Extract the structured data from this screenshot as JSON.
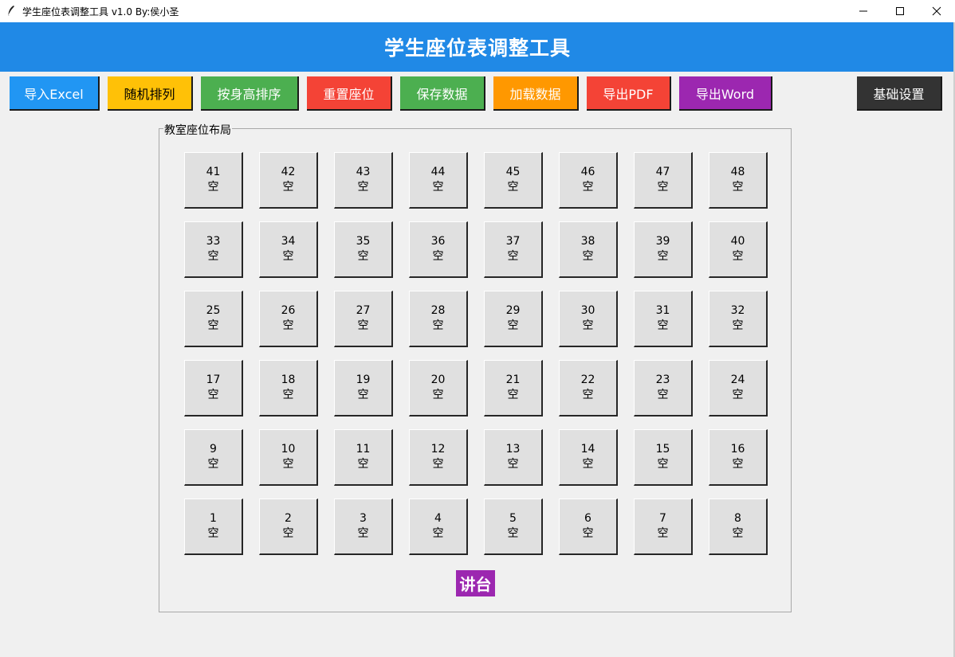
{
  "window": {
    "title": "学生座位表调整工具 v1.0 By:侯小圣"
  },
  "header": {
    "title": "学生座位表调整工具"
  },
  "toolbar": {
    "buttons": [
      {
        "label": "导入Excel",
        "color": "#2196f3"
      },
      {
        "label": "随机排列",
        "color": "#ffc107"
      },
      {
        "label": "按身高排序",
        "color": "#4caf50"
      },
      {
        "label": "重置座位",
        "color": "#f44336"
      },
      {
        "label": "保存数据",
        "color": "#4caf50"
      },
      {
        "label": "加载数据",
        "color": "#ff9800"
      },
      {
        "label": "导出PDF",
        "color": "#f44336"
      },
      {
        "label": "导出Word",
        "color": "#9c27b0"
      },
      {
        "label": "基础设置",
        "color": "#333333"
      }
    ]
  },
  "classroom": {
    "label": "教室座位布局",
    "rows": [
      [
        {
          "num": "41",
          "name": "空"
        },
        {
          "num": "42",
          "name": "空"
        },
        {
          "num": "43",
          "name": "空"
        },
        {
          "num": "44",
          "name": "空"
        },
        {
          "num": "45",
          "name": "空"
        },
        {
          "num": "46",
          "name": "空"
        },
        {
          "num": "47",
          "name": "空"
        },
        {
          "num": "48",
          "name": "空"
        }
      ],
      [
        {
          "num": "33",
          "name": "空"
        },
        {
          "num": "34",
          "name": "空"
        },
        {
          "num": "35",
          "name": "空"
        },
        {
          "num": "36",
          "name": "空"
        },
        {
          "num": "37",
          "name": "空"
        },
        {
          "num": "38",
          "name": "空"
        },
        {
          "num": "39",
          "name": "空"
        },
        {
          "num": "40",
          "name": "空"
        }
      ],
      [
        {
          "num": "25",
          "name": "空"
        },
        {
          "num": "26",
          "name": "空"
        },
        {
          "num": "27",
          "name": "空"
        },
        {
          "num": "28",
          "name": "空"
        },
        {
          "num": "29",
          "name": "空"
        },
        {
          "num": "30",
          "name": "空"
        },
        {
          "num": "31",
          "name": "空"
        },
        {
          "num": "32",
          "name": "空"
        }
      ],
      [
        {
          "num": "17",
          "name": "空"
        },
        {
          "num": "18",
          "name": "空"
        },
        {
          "num": "19",
          "name": "空"
        },
        {
          "num": "20",
          "name": "空"
        },
        {
          "num": "21",
          "name": "空"
        },
        {
          "num": "22",
          "name": "空"
        },
        {
          "num": "23",
          "name": "空"
        },
        {
          "num": "24",
          "name": "空"
        }
      ],
      [
        {
          "num": "9",
          "name": "空"
        },
        {
          "num": "10",
          "name": "空"
        },
        {
          "num": "11",
          "name": "空"
        },
        {
          "num": "12",
          "name": "空"
        },
        {
          "num": "13",
          "name": "空"
        },
        {
          "num": "14",
          "name": "空"
        },
        {
          "num": "15",
          "name": "空"
        },
        {
          "num": "16",
          "name": "空"
        }
      ],
      [
        {
          "num": "1",
          "name": "空"
        },
        {
          "num": "2",
          "name": "空"
        },
        {
          "num": "3",
          "name": "空"
        },
        {
          "num": "4",
          "name": "空"
        },
        {
          "num": "5",
          "name": "空"
        },
        {
          "num": "6",
          "name": "空"
        },
        {
          "num": "7",
          "name": "空"
        },
        {
          "num": "8",
          "name": "空"
        }
      ]
    ],
    "podium": {
      "label": "讲台",
      "color": "#9c27b0"
    }
  }
}
